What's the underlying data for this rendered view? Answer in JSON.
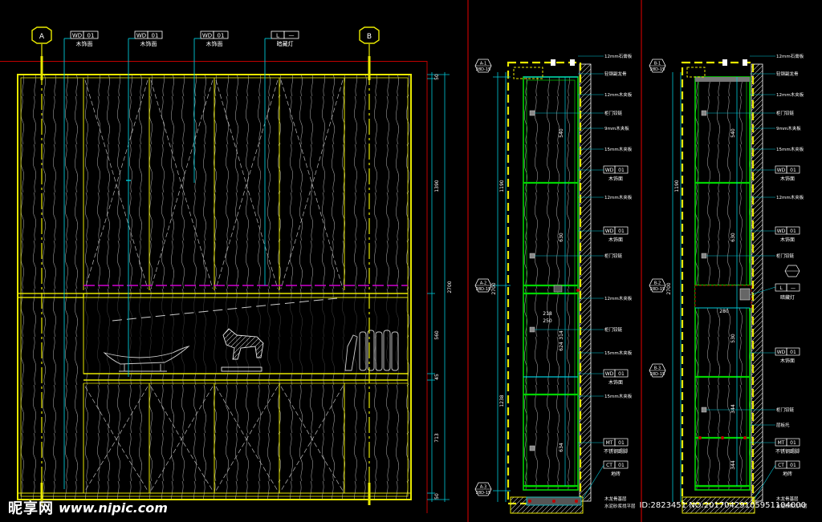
{
  "axes": {
    "left": "A",
    "right": "B"
  },
  "tags": {
    "wd01_a": {
      "code": "WD",
      "num": "01",
      "desc": "木饰面"
    },
    "wd01_b": {
      "code": "WD",
      "num": "01",
      "desc": "木饰面"
    },
    "wd01_c": {
      "code": "WD",
      "num": "01",
      "desc": "木饰面"
    },
    "light": {
      "code": "L",
      "num": "",
      "desc": "暗藏灯"
    }
  },
  "elevation_dims": [
    "50",
    "1390",
    "2700",
    "560",
    "45",
    "713",
    "50"
  ],
  "section_a": {
    "markers": [
      {
        "id": "A-1",
        "sheet": "28D-15"
      },
      {
        "id": "A-2",
        "sheet": "28D-15"
      },
      {
        "id": "A-3",
        "sheet": "28D-15"
      }
    ],
    "dims_left": [
      "1190",
      "2700",
      "1238"
    ],
    "dims_inner": [
      "540",
      "630",
      "314",
      "624",
      "634"
    ],
    "dims_h": [
      "218",
      "250"
    ],
    "notes": [
      "12mm石膏板",
      "轻钢副龙骨",
      "12mm木夹板",
      "柜门铰链",
      "9mm木夹板",
      "15mm木夹板",
      "12mm木夹板",
      "柜门铰链",
      "12mm木夹板",
      "柜门铰链",
      "15mm木夹板",
      "15mm木夹板",
      "不锈钢踢脚",
      "地砖",
      "水泥砂浆找平层"
    ],
    "wd": {
      "code": "WD",
      "num": "01",
      "desc": "木饰面"
    },
    "wd2": {
      "code": "WD",
      "num": "01",
      "desc": "木饰面"
    },
    "wd3": {
      "code": "WD",
      "num": "01",
      "desc": "木饰面"
    },
    "mt": {
      "code": "MT",
      "num": "01",
      "desc": "不锈钢踢脚"
    },
    "ct": {
      "code": "CT",
      "num": "01",
      "desc": "地砖"
    },
    "bottom": [
      "木龙骨基层",
      "水泥砂浆找平层"
    ]
  },
  "section_b": {
    "markers": [
      {
        "id": "B-1",
        "sheet": "28D-15"
      },
      {
        "id": "B-2",
        "sheet": "28D-15"
      },
      {
        "id": "B-3",
        "sheet": "28D-15"
      }
    ],
    "dims_left": [
      "1190",
      "2700"
    ],
    "dims_inner": [
      "540",
      "630",
      "280",
      "530",
      "344",
      "344"
    ],
    "notes": [
      "12mm石膏板",
      "轻钢副龙骨",
      "12mm木夹板",
      "柜门铰链",
      "9mm木夹板",
      "15mm木夹板",
      "12mm木夹板",
      "柜门铰链",
      "暗藏灯",
      "柜门铰链",
      "层板托"
    ],
    "wd": {
      "code": "WD",
      "num": "01",
      "desc": "木饰面"
    },
    "wd2": {
      "code": "WD",
      "num": "01",
      "desc": "木饰面"
    },
    "wd3": {
      "code": "WD",
      "num": "01",
      "desc": "木饰面"
    },
    "light": {
      "code": "L",
      "num": "",
      "desc": "暗藏灯"
    },
    "mt": {
      "code": "MT",
      "num": "01",
      "desc": "不锈钢踢脚"
    },
    "ct": {
      "code": "CT",
      "num": "01",
      "desc": "地砖"
    },
    "bottom": [
      "木龙骨基层",
      "水泥砂浆找平层"
    ]
  },
  "watermark": {
    "logo": "昵享网",
    "url": "www.nipic.com",
    "id": "ID:2823451 NO:20170429105951104000"
  },
  "colors": {
    "background": "#000000",
    "yellow": "#e8e800",
    "green": "#00d400",
    "cyan": "#00c8d8",
    "red": "#c00000",
    "magenta": "#d000d0",
    "white": "#ffffff"
  }
}
